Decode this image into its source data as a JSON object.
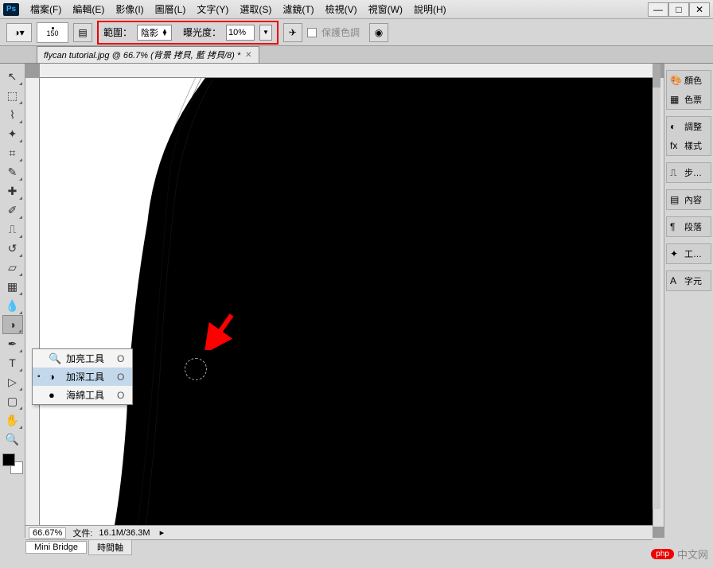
{
  "app": {
    "logo": "Ps"
  },
  "menu": [
    {
      "label": "檔案(F)"
    },
    {
      "label": "編輯(E)"
    },
    {
      "label": "影像(I)"
    },
    {
      "label": "圖層(L)"
    },
    {
      "label": "文字(Y)"
    },
    {
      "label": "選取(S)"
    },
    {
      "label": "濾鏡(T)"
    },
    {
      "label": "檢視(V)"
    },
    {
      "label": "視窗(W)"
    },
    {
      "label": "說明(H)"
    }
  ],
  "window_controls": {
    "min": "—",
    "max": "□",
    "close": "✕"
  },
  "options": {
    "brush_size": "150",
    "range_label": "範圍：",
    "range_value": "陰影",
    "exposure_label": "曝光度：",
    "exposure_value": "10%",
    "protect_tones": "保護色調"
  },
  "doc_tab": {
    "title": "flycan tutorial.jpg @ 66.7% (背景 拷貝, 藍 拷貝/8) *"
  },
  "tools": [
    {
      "name": "move",
      "g": "↖"
    },
    {
      "name": "marquee",
      "g": "⬚"
    },
    {
      "name": "lasso",
      "g": "⌇"
    },
    {
      "name": "magic-wand",
      "g": "✦"
    },
    {
      "name": "crop",
      "g": "✂"
    },
    {
      "name": "eyedropper",
      "g": "✎"
    },
    {
      "name": "healing",
      "g": "✚"
    },
    {
      "name": "brush",
      "g": "✐"
    },
    {
      "name": "stamp",
      "g": "⎍"
    },
    {
      "name": "history-brush",
      "g": "↺"
    },
    {
      "name": "eraser",
      "g": "▭"
    },
    {
      "name": "gradient",
      "g": "▦"
    },
    {
      "name": "blur",
      "g": "●"
    },
    {
      "name": "dodge-burn",
      "g": "◑",
      "active": true
    },
    {
      "name": "pen",
      "g": "✒"
    },
    {
      "name": "type",
      "g": "T"
    },
    {
      "name": "path",
      "g": "▷"
    },
    {
      "name": "shape",
      "g": "▢"
    },
    {
      "name": "hand",
      "g": "✋"
    },
    {
      "name": "zoom",
      "g": "🔍"
    }
  ],
  "flyout": {
    "items": [
      {
        "icon": "🔍",
        "label": "加亮工具",
        "key": "O",
        "selected": false
      },
      {
        "icon": "◑",
        "label": "加深工具",
        "key": "O",
        "selected": true
      },
      {
        "icon": "●",
        "label": "海綿工具",
        "key": "O",
        "selected": false
      }
    ]
  },
  "panels": [
    [
      {
        "icon": "🎨",
        "label": "顏色"
      },
      {
        "icon": "▦",
        "label": "色票"
      }
    ],
    [
      {
        "icon": "◐",
        "label": "調整"
      },
      {
        "icon": "fx",
        "label": "樣式"
      }
    ],
    [
      {
        "icon": "⎍",
        "label": "步…"
      }
    ],
    [
      {
        "icon": "▤",
        "label": "內容"
      }
    ],
    [
      {
        "icon": "¶",
        "label": "段落"
      }
    ],
    [
      {
        "icon": "✦",
        "label": "工…"
      }
    ],
    [
      {
        "icon": "A",
        "label": "字元"
      }
    ]
  ],
  "status": {
    "zoom": "66.67%",
    "doc_label": "文件:",
    "doc_size": "16.1M/36.3M"
  },
  "bottom_tabs": [
    {
      "label": "Mini Bridge",
      "active": true
    },
    {
      "label": "時間軸",
      "active": false
    }
  ],
  "watermark": {
    "badge": "php",
    "text": "中文网"
  }
}
